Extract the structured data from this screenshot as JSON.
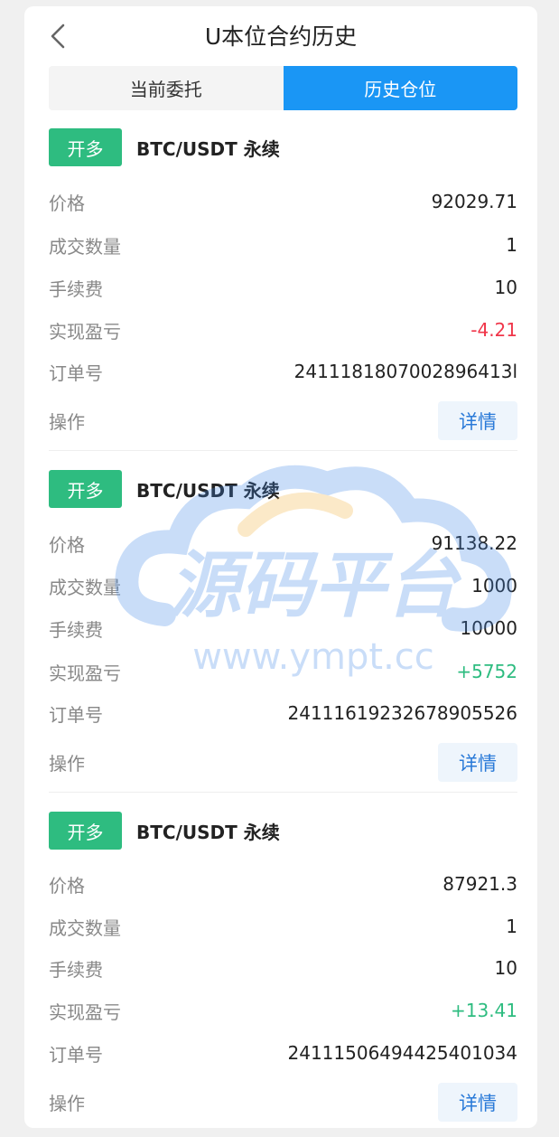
{
  "header": {
    "title": "U本位合约历史",
    "back_icon": "chevron-left-icon"
  },
  "tabs": [
    {
      "label": "当前委托",
      "active": false
    },
    {
      "label": "历史仓位",
      "active": true
    }
  ],
  "labels": {
    "price": "价格",
    "qty": "成交数量",
    "fee": "手续费",
    "pnl": "实现盈亏",
    "order_no": "订单号",
    "action": "操作",
    "detail": "详情"
  },
  "orders": [
    {
      "side": "开多",
      "symbol": "BTC/USDT 永续",
      "price": "92029.71",
      "qty": "1",
      "fee": "10",
      "pnl": "-4.21",
      "order_no": "2411181807002896413l"
    },
    {
      "side": "开多",
      "symbol": "BTC/USDT 永续",
      "price": "91138.22",
      "qty": "1000",
      "fee": "10000",
      "pnl": "+5752",
      "order_no": "2411161923267890552​6"
    },
    {
      "side": "开多",
      "symbol": "BTC/USDT 永续",
      "price": "87921.3",
      "qty": "1",
      "fee": "10",
      "pnl": "+13.41",
      "order_no": "24111506494425401034"
    }
  ],
  "watermark": {
    "brand": "源码平台",
    "url": "www.ympt.cc"
  },
  "colors": {
    "accent": "#1a96f5",
    "buy": "#2ebc80",
    "loss": "#f0364a",
    "profit": "#2ebc80",
    "detail_text": "#2a7ad8"
  }
}
